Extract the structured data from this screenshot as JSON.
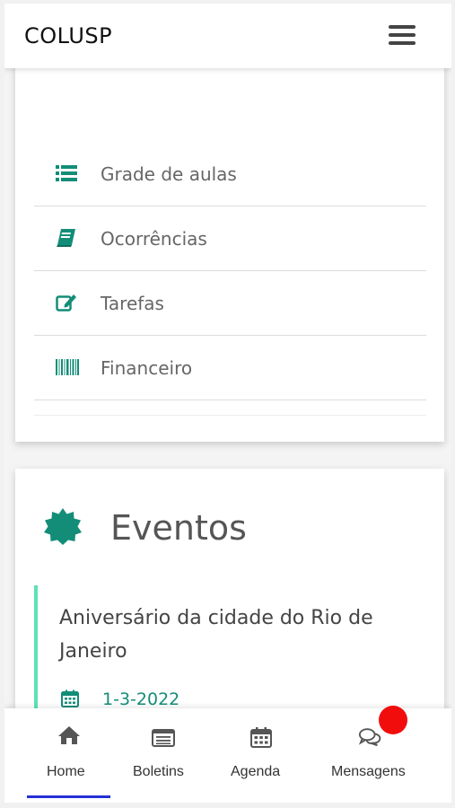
{
  "app": {
    "title": "COLUSP"
  },
  "menu": {
    "items": [
      {
        "label": "Grade de aulas",
        "icon": "list-icon"
      },
      {
        "label": "Ocorrências",
        "icon": "book-icon"
      },
      {
        "label": "Tarefas",
        "icon": "edit-icon"
      },
      {
        "label": "Financeiro",
        "icon": "barcode-icon"
      }
    ]
  },
  "events": {
    "title": "Eventos",
    "icon": "badge-icon",
    "items": [
      {
        "name": "Aniversário da cidade do Rio de Janeiro",
        "date": "1-3-2022"
      }
    ]
  },
  "bottom_nav": {
    "items": [
      {
        "label": "Home",
        "icon": "home-icon",
        "active": true
      },
      {
        "label": "Boletins",
        "icon": "report-card-icon",
        "active": false
      },
      {
        "label": "Agenda",
        "icon": "calendar-icon",
        "active": false
      },
      {
        "label": "Mensagens",
        "icon": "chat-icon",
        "active": false
      }
    ],
    "notification_color": "#f20d0d",
    "active_color": "#2530d6"
  },
  "colors": {
    "accent": "#138d78",
    "event_border": "#5ce2b8"
  }
}
